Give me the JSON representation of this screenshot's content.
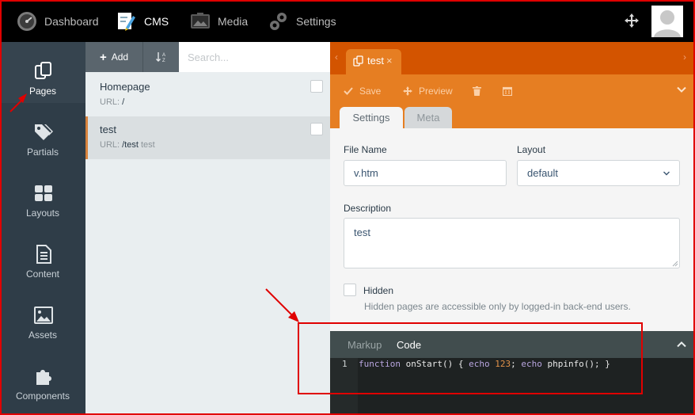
{
  "topbar": {
    "nav": [
      {
        "label": "Dashboard",
        "icon": "dashboard-gauge-icon"
      },
      {
        "label": "CMS",
        "icon": "cms-pencil-icon"
      },
      {
        "label": "Media",
        "icon": "media-image-icon"
      },
      {
        "label": "Settings",
        "icon": "settings-gears-icon"
      }
    ],
    "active": "CMS"
  },
  "sidebar": {
    "items": [
      {
        "label": "Pages",
        "icon": "pages-icon"
      },
      {
        "label": "Partials",
        "icon": "partials-tags-icon"
      },
      {
        "label": "Layouts",
        "icon": "layouts-grid-icon"
      },
      {
        "label": "Content",
        "icon": "content-document-icon"
      },
      {
        "label": "Assets",
        "icon": "assets-image-icon"
      },
      {
        "label": "Components",
        "icon": "components-puzzle-icon"
      }
    ],
    "active": "Pages"
  },
  "list": {
    "add_label": "Add",
    "search_placeholder": "Search...",
    "pages": [
      {
        "title": "Homepage",
        "url_prefix": "URL:",
        "url": "/",
        "extra": ""
      },
      {
        "title": "test",
        "url_prefix": "URL:",
        "url": "/test",
        "extra": "test"
      }
    ],
    "selected": "test"
  },
  "editor": {
    "tab_title": "test",
    "toolbar": {
      "save": "Save",
      "preview": "Preview"
    },
    "subtabs": {
      "settings": "Settings",
      "meta": "Meta"
    },
    "form": {
      "file_name_label": "File Name",
      "file_name_value": "v.htm",
      "layout_label": "Layout",
      "layout_value": "default",
      "description_label": "Description",
      "description_value": "test",
      "hidden_label": "Hidden",
      "hidden_help": "Hidden pages are accessible only by logged-in back-end users."
    },
    "code": {
      "tabs": {
        "markup": "Markup",
        "code": "Code"
      },
      "line_number": "1",
      "line": {
        "kw1": "function",
        "name": " onStart() { ",
        "kw2": "echo",
        "n1": "123",
        "mid": "; ",
        "kw3": "echo",
        "tail": " phpinfo(); }"
      }
    }
  },
  "colors": {
    "topbar": "#000000",
    "sidebar": "#2f3d48",
    "accent_orange": "#e67e22",
    "tab_orange": "#d35400",
    "annotation_red": "#e00000"
  }
}
